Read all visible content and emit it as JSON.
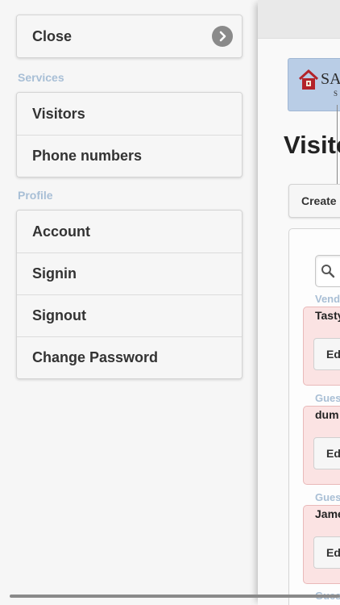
{
  "menu": {
    "close_label": "Close",
    "services_heading": "Services",
    "services_items": [
      "Visitors",
      "Phone numbers"
    ],
    "profile_heading": "Profile",
    "profile_items": [
      "Account",
      "Signin",
      "Signout",
      "Change Password"
    ]
  },
  "page": {
    "logo_text": "SA",
    "logo_subtext": "SO",
    "title": "Visito",
    "create_label": "Create",
    "edit_label": "Ed",
    "cards": [
      {
        "type": "Vend",
        "name": "Tasty"
      },
      {
        "type": "Gues",
        "name": "dum"
      },
      {
        "type": "Gues",
        "name": "Jame"
      },
      {
        "type": "Gues",
        "name": ""
      }
    ]
  },
  "colors": {
    "divider_text": "#a8bfd6",
    "card_background": "#fbe3e3",
    "logo_background": "#b9cde6"
  }
}
